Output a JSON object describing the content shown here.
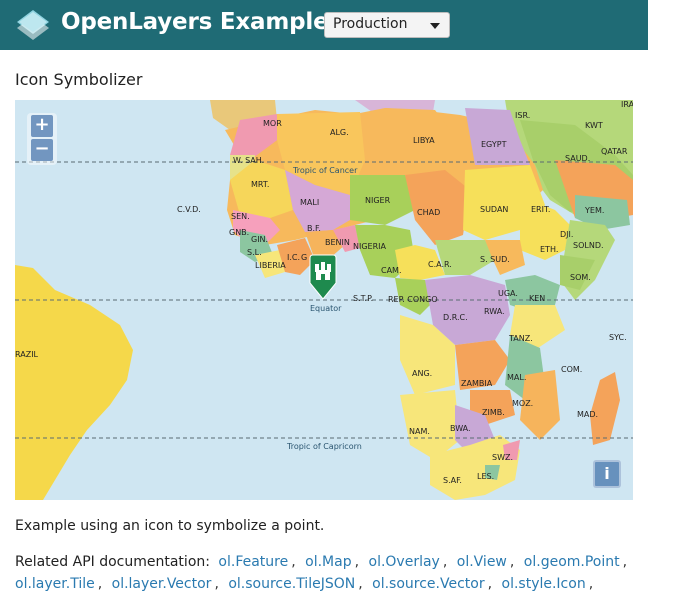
{
  "navbar": {
    "brand": "OpenLayers Examples",
    "version_selected": "Production"
  },
  "page": {
    "title": "Icon Symbolizer",
    "description": "Example using an icon to symbolize a point."
  },
  "map": {
    "zoom_in": "+",
    "zoom_out": "−",
    "attribution_button": "i",
    "latitude_lines": [
      "Tropic of Cancer",
      "Equator",
      "Tropic of Capricorn"
    ],
    "country_labels": [
      "MOR",
      "ALG.",
      "LIBYA",
      "EGYPT",
      "ISR.",
      "IRA",
      "KWT",
      "QATAR",
      "SAUD.",
      "W. SAH.",
      "MRT.",
      "MALI",
      "NIGER",
      "CHAD",
      "SUDAN",
      "ERIT.",
      "YEM.",
      "C.V.D.",
      "SEN.",
      "GNB.",
      "GIN.",
      "S.L.",
      "LIBERIA",
      "I.C.",
      "G",
      "B.F.",
      "BENIN",
      "NIGERIA",
      "C.A.R.",
      "S. SUD.",
      "ETH.",
      "DJI.",
      "SOLND.",
      "SOM.",
      "CAM.",
      "S.T.P.",
      "REP. CONGO",
      "D.R.C.",
      "UGA.",
      "KEN",
      "RWA.",
      "TANZ.",
      "SYC.",
      "COM.",
      "ANG.",
      "ZAMBIA",
      "MAL.",
      "MOZ.",
      "MAD.",
      "ZIMB.",
      "NAM.",
      "BWA.",
      "SWZ.",
      "LES.",
      "S.AF.",
      "RAZIL"
    ],
    "marker_icon": "marker-pin-icon"
  },
  "api_docs": {
    "label": "Related API documentation:",
    "links": [
      "ol.Feature",
      "ol.Map",
      "ol.Overlay",
      "ol.View",
      "ol.geom.Point",
      "ol.layer.Tile",
      "ol.layer.Vector",
      "ol.source.TileJSON",
      "ol.source.Vector",
      "ol.style.Icon"
    ]
  },
  "colors": {
    "navbar": "#1f6b75",
    "link": "#2a7ab0",
    "ocean": "#cfe6f2",
    "marker": "#1e8a4e"
  }
}
